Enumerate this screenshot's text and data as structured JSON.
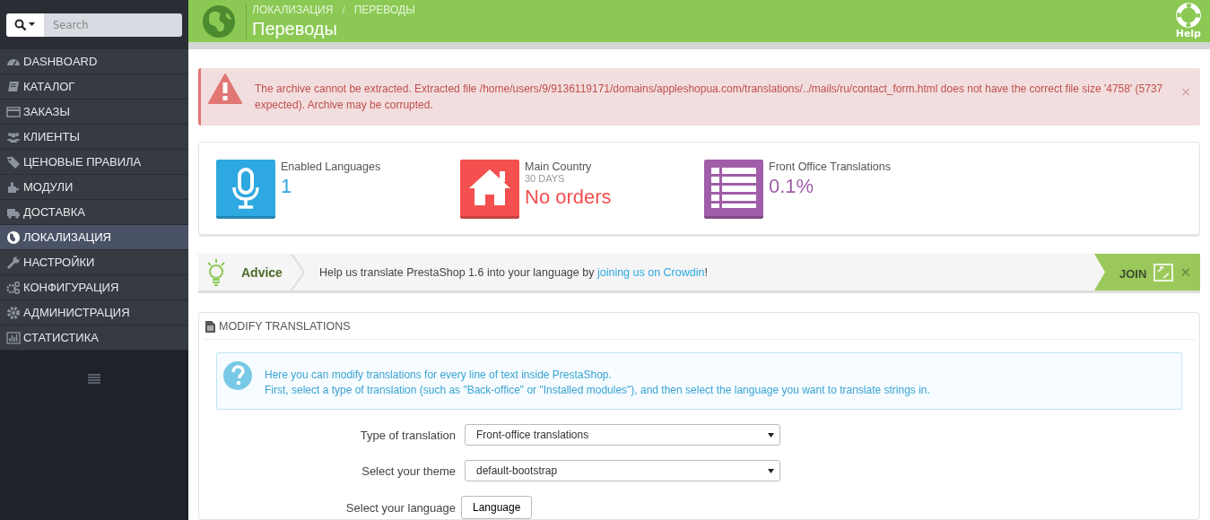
{
  "sidebar": {
    "search": {
      "placeholder": "Search"
    },
    "items": [
      {
        "label": "DASHBOARD",
        "selected": false
      },
      {
        "label": "КАТАЛОГ",
        "selected": false
      },
      {
        "label": "ЗАКАЗЫ",
        "selected": false
      },
      {
        "label": "КЛИЕНТЫ",
        "selected": false
      },
      {
        "label": "ЦЕНОВЫЕ ПРАВИЛА",
        "selected": false
      },
      {
        "label": "МОДУЛИ",
        "selected": false
      },
      {
        "label": "ДОСТАВКА",
        "selected": false
      },
      {
        "label": "ЛОКАЛИЗАЦИЯ",
        "selected": true
      },
      {
        "label": "НАСТРОЙКИ",
        "selected": false
      },
      {
        "label": "КОНФИГУРАЦИЯ",
        "selected": false
      },
      {
        "label": "АДМИНИСТРАЦИЯ",
        "selected": false
      },
      {
        "label": "СТАТИСТИКА",
        "selected": false
      }
    ]
  },
  "header": {
    "breadcrumb": [
      "ЛОКАЛИЗАЦИЯ",
      "ПЕРЕВОДЫ"
    ],
    "separator": "/",
    "title": "Переводы",
    "help": "Help"
  },
  "alert": {
    "text": "The archive cannot be extracted. Extracted file /home/users/9/9136119171/domains/appleshopua.com/translations/../mails/ru/contact_form.html does not have the correct file size '4758' (5737 expected). Archive may be corrupted.",
    "close": "×"
  },
  "kpis": [
    {
      "color": "#2ea8e0",
      "label": "Enabled Languages",
      "value": "1"
    },
    {
      "color": "#f4504f",
      "label": "Main Country",
      "sublabel": "30 DAYS",
      "value": "No orders"
    },
    {
      "color": "#a05da8",
      "label": "Front Office Translations",
      "value": "0.1%"
    }
  ],
  "advice": {
    "title": "Advice",
    "text": "Help us translate PrestaShop 1.6 into your language by ",
    "link": "joining us on Crowdin",
    "after": "!",
    "join": "JOIN",
    "close": "✕"
  },
  "panel": {
    "title": "MODIFY TRANSLATIONS",
    "info": [
      "Here you can modify translations for every line of text inside PrestaShop.",
      "First, select a type of translation (such as \"Back-office\" or \"Installed modules\"), and then select the language you want to translate strings in."
    ],
    "fields": [
      {
        "label": "Type of translation",
        "value": "Front-office translations",
        "kind": "select"
      },
      {
        "label": "Select your theme",
        "value": "default-bootstrap",
        "kind": "select"
      },
      {
        "label": "Select your language",
        "value": "Language",
        "kind": "button"
      }
    ]
  }
}
